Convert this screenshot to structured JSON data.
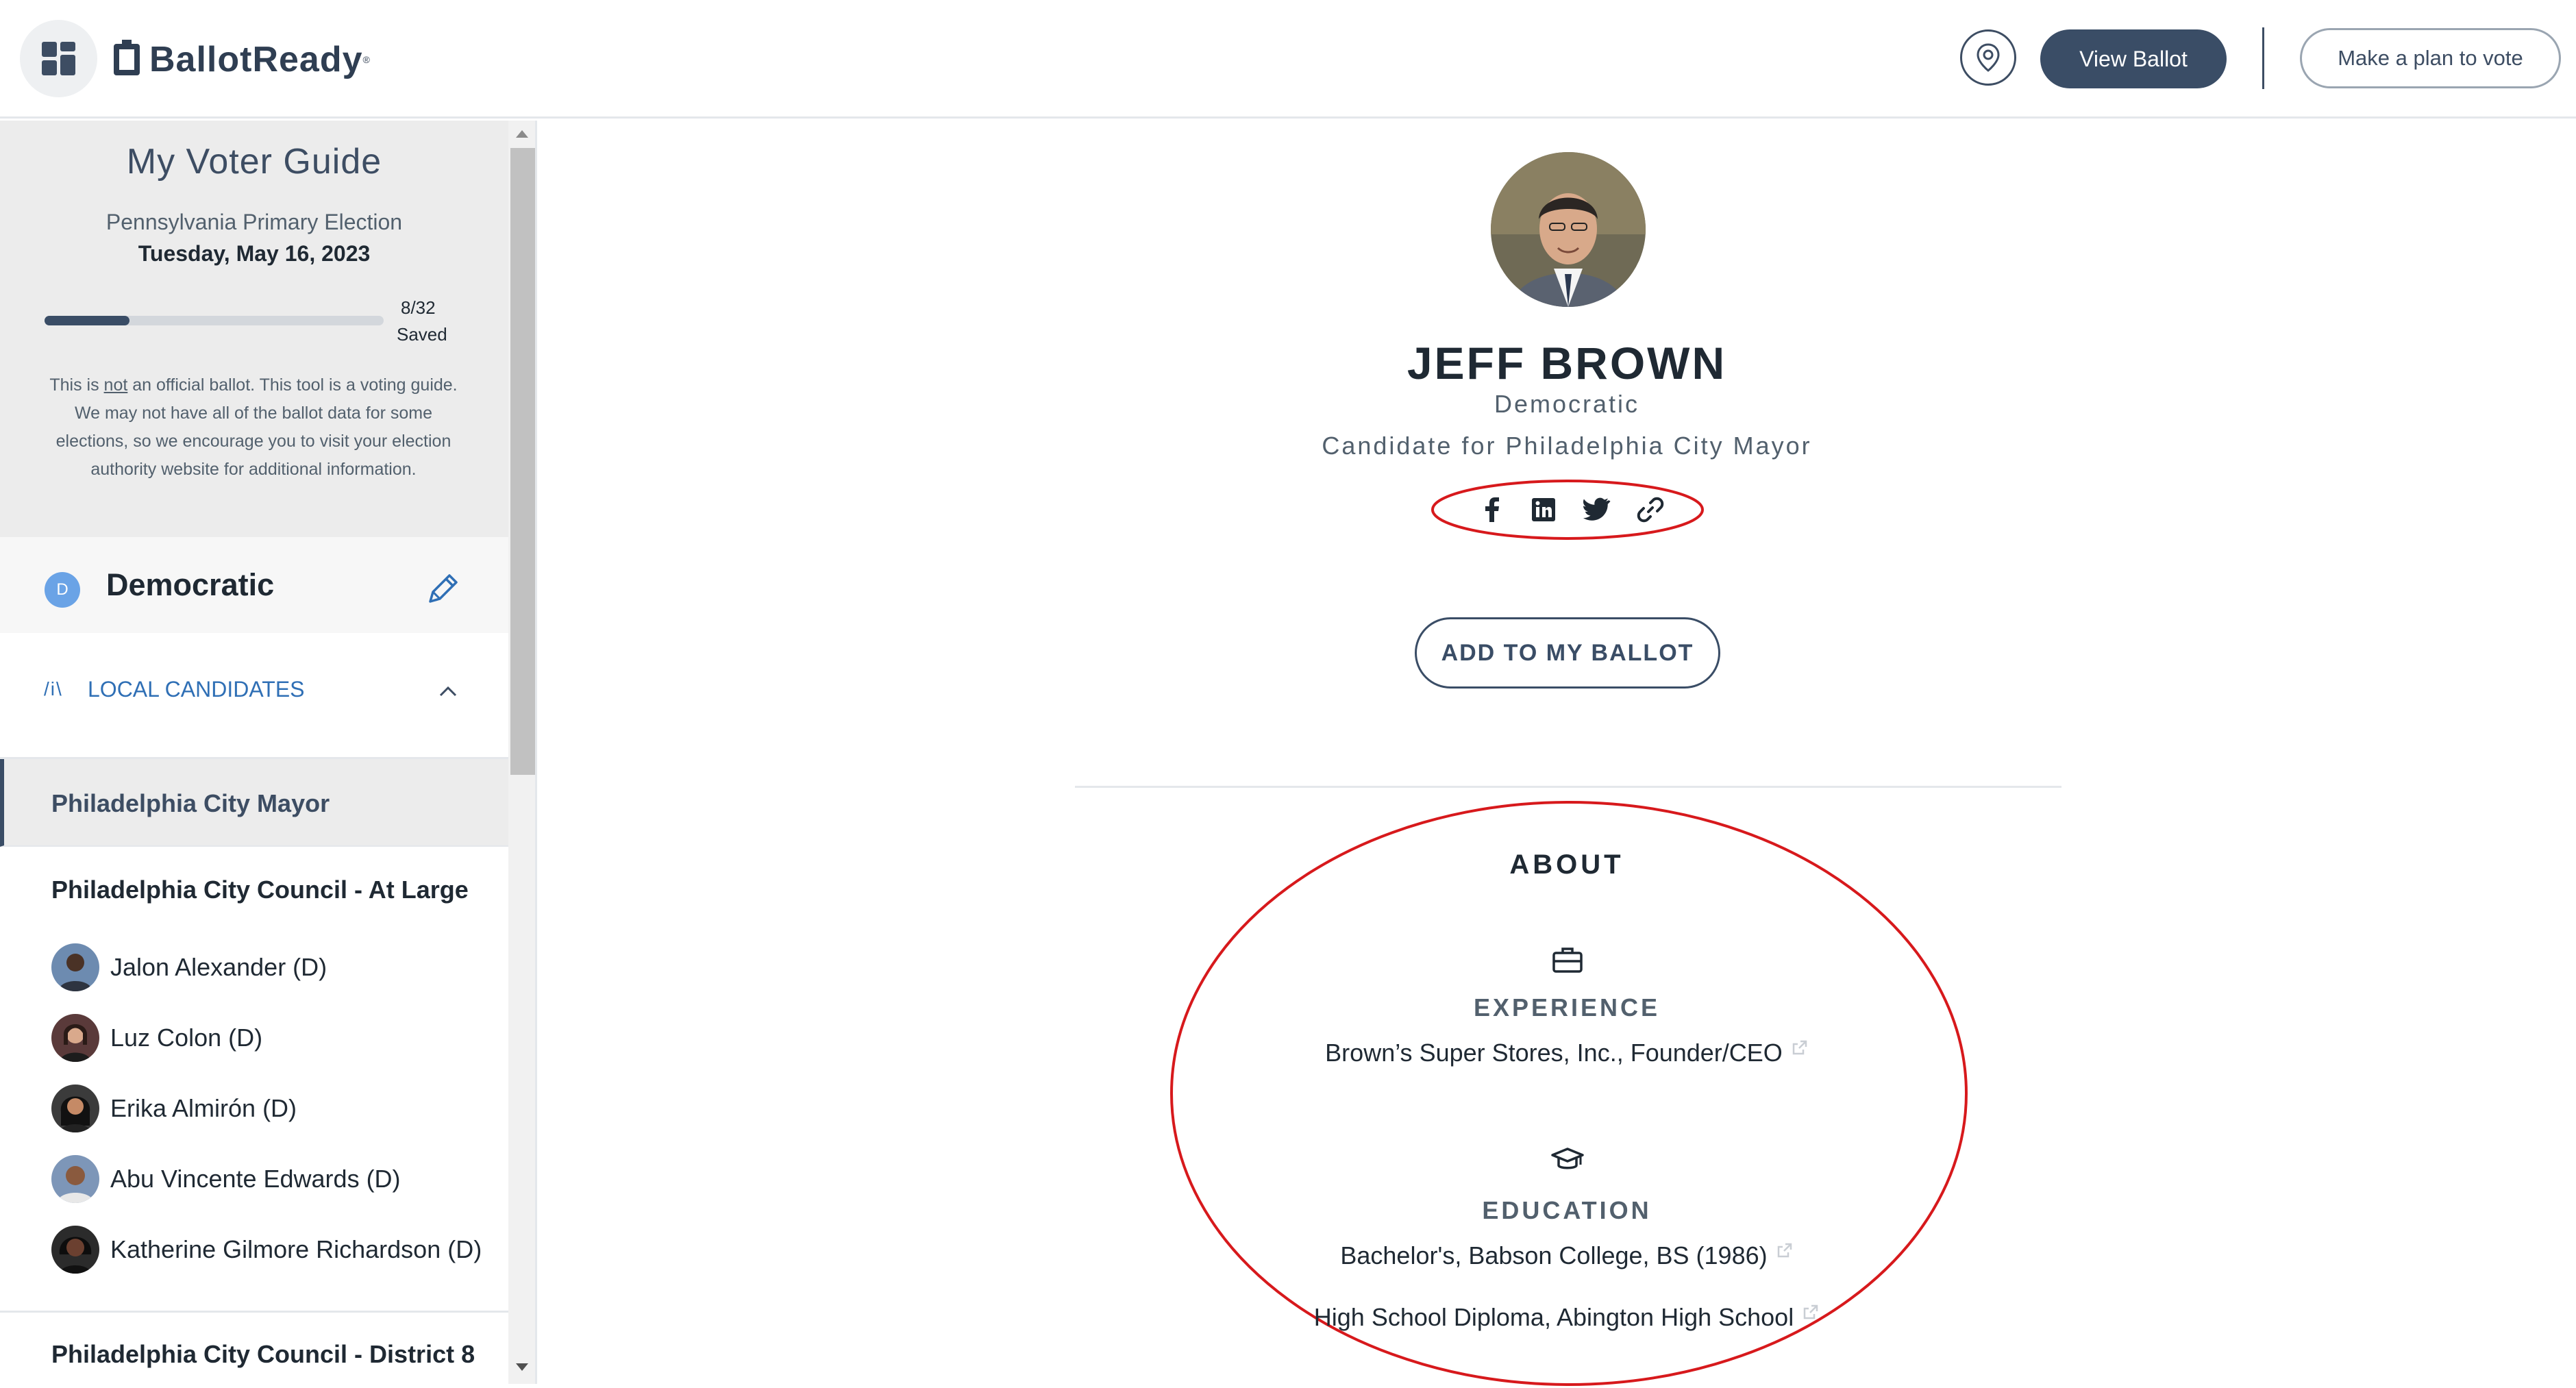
{
  "header": {
    "logo_text": "BallotReady",
    "logo_reg": "®",
    "location_icon": "map-pin-icon",
    "view_ballot_label": "View Ballot",
    "plan_label": "Make a plan to vote"
  },
  "sidebar": {
    "title": "My Voter Guide",
    "election_name": "Pennsylvania Primary Election",
    "election_date": "Tuesday, May 16, 2023",
    "progress": {
      "saved": 8,
      "total": 32,
      "count_text": "8/32",
      "saved_label": "Saved"
    },
    "disclaimer_pre": "This is ",
    "disclaimer_not": "not",
    "disclaimer_post": " an official ballot. This tool is a voting guide. We may not have all of the ballot data for some elections, so we encourage you to visit your election authority website for additional information.",
    "party": {
      "badge": "D",
      "name": "Democratic",
      "edit_icon": "pencil-icon"
    },
    "section": {
      "icon_text": "/i\\",
      "label": "LOCAL CANDIDATES"
    },
    "active_race": "Philadelphia City Mayor",
    "race_2": {
      "title": "Philadelphia City Council - At Large",
      "candidates": [
        "Jalon Alexander (D)",
        "Luz Colon (D)",
        "Erika Almirón (D)",
        "Abu Vincente Edwards (D)",
        "Katherine Gilmore Richardson (D)"
      ]
    },
    "race_3": {
      "title": "Philadelphia City Council - District 8"
    }
  },
  "candidate": {
    "name": "JEFF BROWN",
    "party": "Democratic",
    "office": "Candidate for Philadelphia City Mayor",
    "social_icons": [
      "facebook-icon",
      "linkedin-icon",
      "twitter-icon",
      "link-icon"
    ],
    "add_label": "ADD TO MY BALLOT"
  },
  "about": {
    "title": "ABOUT",
    "experience_head": "EXPERIENCE",
    "experience": [
      "Brown’s Super Stores, Inc., Founder/CEO"
    ],
    "education_head": "EDUCATION",
    "education": [
      "Bachelor's, Babson College, BS (1986)",
      "High School Diploma, Abington High School"
    ]
  },
  "colors": {
    "brand_dark": "#3a4d66",
    "link_blue": "#2f6fb5",
    "party_badge": "#6aa3e6",
    "annotation_red": "#d7191c"
  }
}
